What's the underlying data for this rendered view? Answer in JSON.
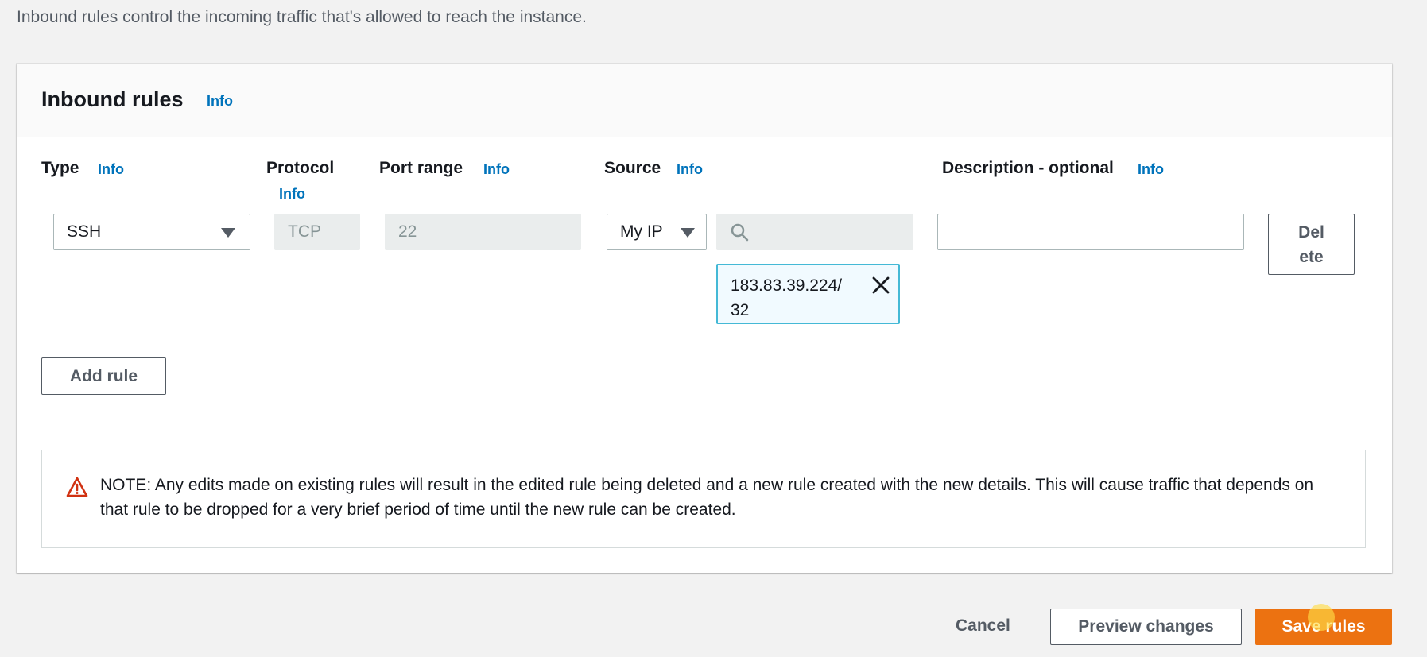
{
  "intro_text": "Inbound rules control the incoming traffic that's allowed to reach the instance.",
  "panel": {
    "title": "Inbound rules",
    "title_info": "Info"
  },
  "columns": {
    "type": {
      "label": "Type",
      "info": "Info"
    },
    "protocol": {
      "label": "Protocol",
      "info": "Info"
    },
    "port_range": {
      "label": "Port range",
      "info": "Info"
    },
    "source": {
      "label": "Source",
      "info": "Info"
    },
    "description": {
      "label": "Description - optional",
      "info": "Info"
    }
  },
  "rule": {
    "type_value": "SSH",
    "protocol_value": "TCP",
    "port_value": "22",
    "source_value": "My IP",
    "source_search_value": "",
    "source_token_line1": "183.83.39.224/",
    "source_token_line2": "32",
    "description_value": "",
    "delete_line1": "Del",
    "delete_line2": "ete"
  },
  "add_rule_label": "Add rule",
  "note_text": "NOTE: Any edits made on existing rules will result in the edited rule being deleted and a new rule created with the new details. This will cause traffic that depends on that rule to be dropped for a very brief period of time until the new rule can be created.",
  "footer": {
    "cancel_label": "Cancel",
    "preview_label": "Preview changes",
    "save_label": "Save rules"
  },
  "colors": {
    "link": "#0073bb",
    "primary": "#ec7211",
    "token_border": "#44b9d6",
    "warning": "#d13212"
  }
}
